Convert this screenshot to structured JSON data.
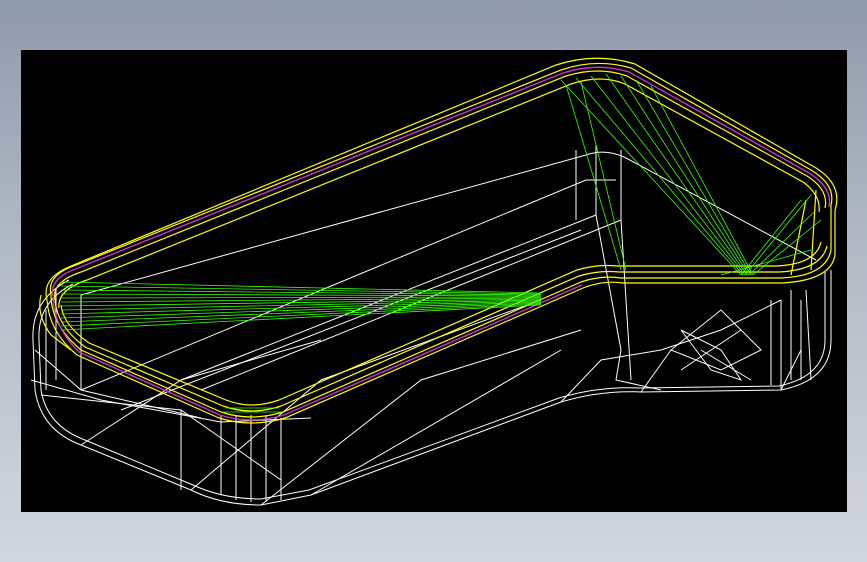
{
  "viewport": {
    "background": "#000000",
    "style": "wireframe"
  },
  "model": {
    "shape": "rounded rectangular tray",
    "colors": {
      "edges": "#ffffff",
      "rim": "#ffff00",
      "accent": "#cc33cc",
      "highlight": "#33ff00"
    }
  },
  "page": {
    "background_top": "#8f9aaa",
    "background_bottom": "#d2d6de"
  }
}
